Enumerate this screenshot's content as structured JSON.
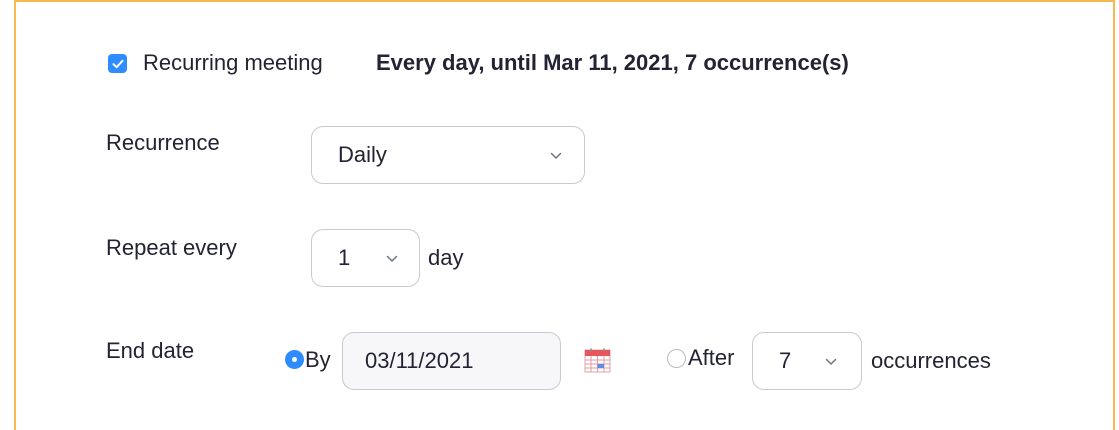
{
  "recurring": {
    "checked": true,
    "label": "Recurring meeting",
    "summary": "Every day, until Mar 11, 2021, 7 occurrence(s)"
  },
  "recurrence": {
    "label": "Recurrence",
    "selected": "Daily",
    "icon": "chevron-down-icon"
  },
  "repeat_every": {
    "label": "Repeat every",
    "selected": "1",
    "unit": "day",
    "icon": "chevron-down-icon"
  },
  "end_date": {
    "label": "End date",
    "by": {
      "selected": true,
      "label": "By",
      "value": "03/11/2021",
      "icon": "calendar-icon"
    },
    "after": {
      "selected": false,
      "label": "After",
      "count": "7",
      "unit": "occurrences",
      "icon": "chevron-down-icon"
    }
  },
  "colors": {
    "accent": "#2d8cff",
    "frame_border": "#f6b94e",
    "text": "#232333",
    "input_border": "#c9cad1"
  }
}
